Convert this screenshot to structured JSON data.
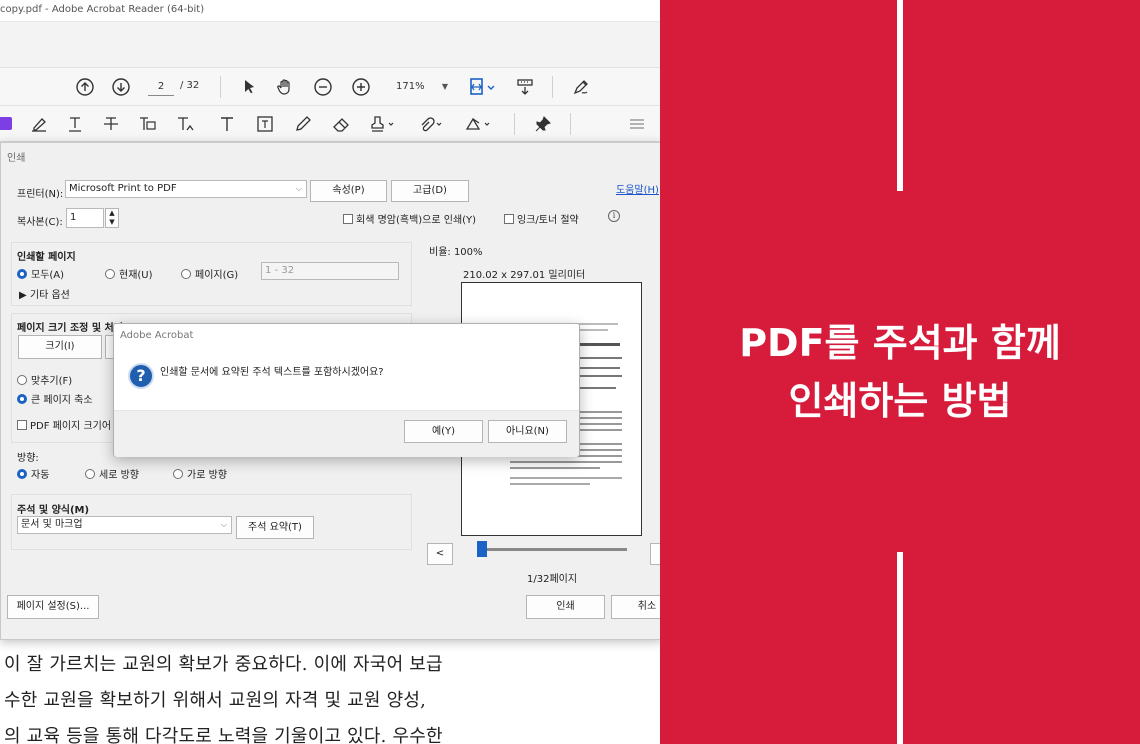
{
  "window": {
    "title": "copy.pdf - Adobe Acrobat Reader (64-bit)"
  },
  "toolbar": {
    "page_current": "2",
    "page_total": "/ 32",
    "zoom": "171%"
  },
  "print_dialog": {
    "title": "인쇄",
    "printer_label": "프린터(N):",
    "printer_value": "Microsoft Print to PDF",
    "properties_button": "속성(P)",
    "advanced_button": "고급(D)",
    "help_link": "도움말(H)",
    "copies_label": "복사본(C):",
    "copies_value": "1",
    "grayscale_label": "회색 명암(흑백)으로 인쇄(Y)",
    "ink_save_label": "잉크/토너 절약",
    "pages_heading": "인쇄할 페이지",
    "pages_all": "모두(A)",
    "pages_current": "현재(U)",
    "pages_range": "페이지(G)",
    "pages_range_value": "1 - 32",
    "more_options": "▶ 기타 옵션",
    "sizing_heading": "페이지 크기 조정 및 처리",
    "size_button": "크기(I)",
    "fit_label": "맞추기(F)",
    "shrink_label": "큰 페이지 축소",
    "pdf_size_label": "PDF 페이지 크기어",
    "orientation_heading": "방향:",
    "orient_auto": "자동",
    "orient_portrait": "세로 방향",
    "orient_landscape": "가로 방향",
    "comments_heading": "주석 및 양식(M)",
    "comments_value": "문서 및 마크업",
    "summarize_button": "주석 요약(T)",
    "scale_label": "비율: 100%",
    "paper_size": "210.02 x 297.01 밀리미터",
    "prev_button": "<",
    "page_indicator": "1/32페이지",
    "page_setup_button": "페이지 설정(S)...",
    "print_button": "인쇄",
    "cancel_button": "취소"
  },
  "alert": {
    "title": "Adobe Acrobat",
    "message": "인쇄할 문서에 요약된 주석 텍스트를 포함하시겠어요?",
    "yes_button": "예(Y)",
    "no_button": "아니요(N)"
  },
  "document_text": [
    "이 잘 가르치는 교원의 확보가 중요하다. 이에 자국어 보급",
    "수한 교원을 확보하기 위해서 교원의 자격 및 교원 양성,",
    "의 교육 등을 통해 다각도로 노력을 기울이고 있다. 우수한"
  ],
  "banner": {
    "line1": "PDF를 주석과 함께",
    "line2": "인쇄하는 방법",
    "background_color": "#d61b3b"
  }
}
